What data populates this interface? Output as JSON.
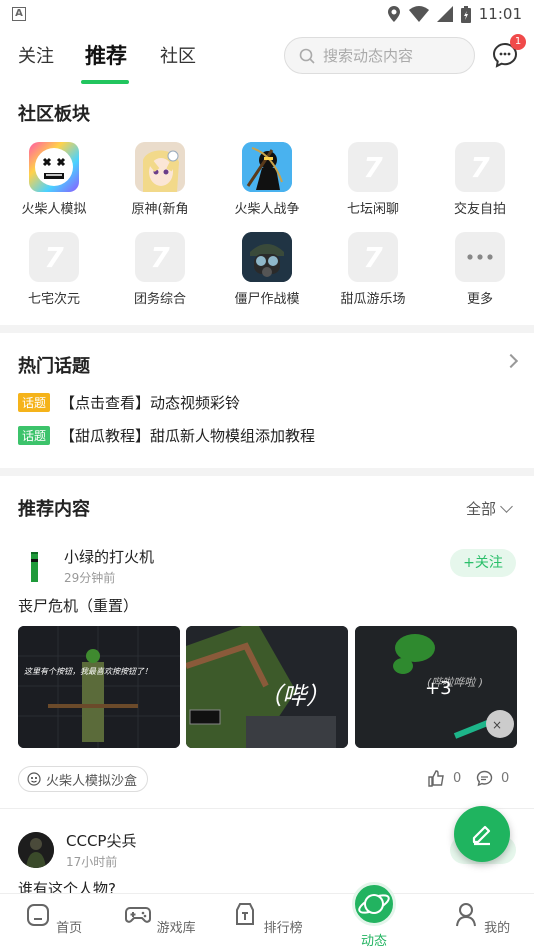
{
  "status_bar": {
    "time": "11:01",
    "app_icon_letter": "A"
  },
  "top_nav": {
    "tabs": [
      "关注",
      "推荐",
      "社区"
    ],
    "active_tab": "推荐",
    "search_placeholder": "搜索动态内容",
    "message_badge": "1"
  },
  "community": {
    "title": "社区板块",
    "boards": [
      {
        "label": "火柴人模拟",
        "icon": "stickman-face-icon"
      },
      {
        "label": "原神(新角",
        "icon": "genshin-character-icon"
      },
      {
        "label": "火柴人战争",
        "icon": "stick-war-icon"
      },
      {
        "label": "七坛闲聊",
        "icon": "seven-logo-icon"
      },
      {
        "label": "交友自拍",
        "icon": "seven-logo-icon"
      },
      {
        "label": "七宅次元",
        "icon": "seven-logo-icon"
      },
      {
        "label": "团务综合",
        "icon": "seven-logo-icon"
      },
      {
        "label": "僵尸作战模",
        "icon": "gasmask-soldier-icon"
      },
      {
        "label": "甜瓜游乐场",
        "icon": "seven-logo-icon"
      },
      {
        "label": "更多",
        "icon": "more-dots-icon"
      }
    ]
  },
  "hot_topics": {
    "title": "热门话题",
    "items": [
      {
        "tag": "话题",
        "tag_color": "#f5b31a",
        "text": "【点击查看】动态视频彩铃"
      },
      {
        "tag": "话题",
        "tag_color": "#3cc36b",
        "text": "【甜瓜教程】甜瓜新人物模组添加教程"
      }
    ]
  },
  "recommended": {
    "title": "推荐内容",
    "filter": "全部",
    "posts": [
      {
        "author": "小绿的打火机",
        "time": "29分钟前",
        "follow_label": "+关注",
        "text": "丧尸危机（重置）",
        "image_captions": [
          "这里有个按钮，我最喜欢按按钮了！",
          "（哔）",
          "(哔啦哗啦 )"
        ],
        "more_images": "+3",
        "game": "火柴人模拟沙盒",
        "likes": "0",
        "comments": "0"
      },
      {
        "author": "CCCP尖兵",
        "time": "17小时前",
        "text": "谁有这个人物?"
      }
    ]
  },
  "bottom_nav": {
    "items": [
      "首页",
      "游戏库",
      "排行榜",
      "动态",
      "我的"
    ],
    "active": "动态"
  },
  "colors": {
    "accent": "#22b360"
  }
}
